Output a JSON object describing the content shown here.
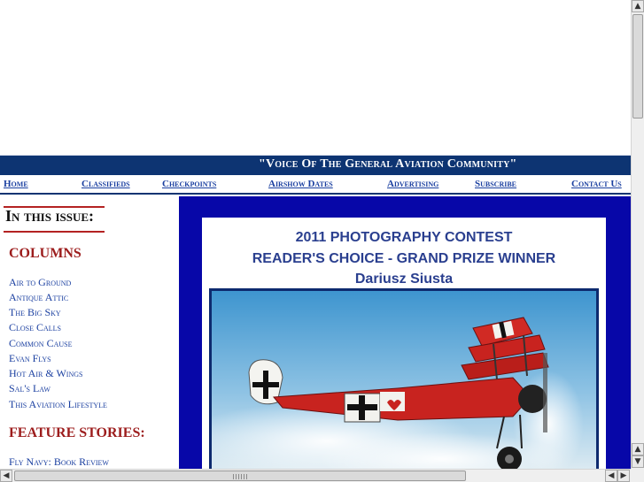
{
  "tagline": "\"Voice Of The General Aviation Community\"",
  "nav": [
    {
      "id": "home",
      "label": "Home"
    },
    {
      "id": "classifieds",
      "label": "Classifieds"
    },
    {
      "id": "checkpoints",
      "label": "Checkpoints"
    },
    {
      "id": "airshow-dates",
      "label": "Airshow Dates"
    },
    {
      "id": "advertising",
      "label": "Advertising"
    },
    {
      "id": "subscribe",
      "label": "Subscribe"
    },
    {
      "id": "contact-us",
      "label": "Contact Us"
    }
  ],
  "sidebar": {
    "title": "In this issue:",
    "columns_heading": "COLUMNS",
    "columns": [
      "Air to Ground",
      "Antique Attic",
      "The Big Sky",
      "Close Calls",
      "Common Cause",
      "Evan Flys",
      "Hot Air & Wings",
      "Sal's Law",
      "This Aviation Lifestyle"
    ],
    "features_heading": "FEATURE STORIES:",
    "features": [
      "Fly Navy: Book Review"
    ]
  },
  "feature": {
    "line1": "2011 PHOTOGRAPHY CONTEST",
    "line2": "READER'S CHOICE - GRAND PRIZE WINNER",
    "line3": "Dariusz Siusta"
  },
  "scrollbars": {
    "up_icon": "arrow-up-icon",
    "down_icon": "arrow-down-icon",
    "left_icon": "arrow-left-icon",
    "right_icon": "arrow-right-icon"
  }
}
